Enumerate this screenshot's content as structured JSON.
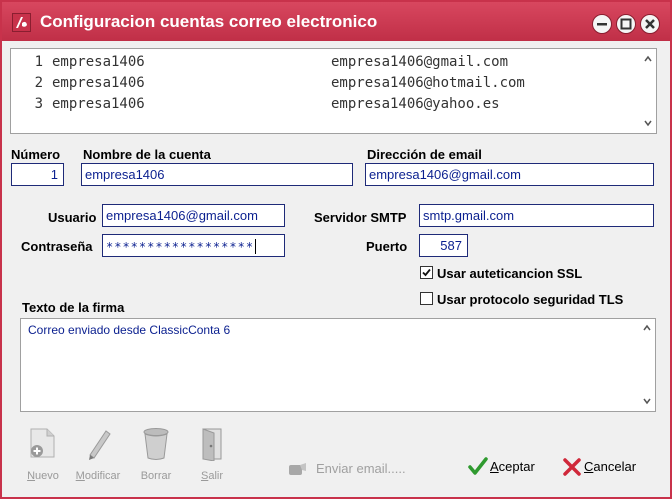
{
  "window": {
    "title": "Configuracion cuentas correo electronico",
    "accent_color": "#c8324b"
  },
  "accounts_list": {
    "rows": [
      {
        "number": "1",
        "name": "empresa1406",
        "email": "empresa1406@gmail.com"
      },
      {
        "number": "2",
        "name": "empresa1406",
        "email": "empresa1406@hotmail.com"
      },
      {
        "number": "3",
        "name": "empresa1406",
        "email": "empresa1406@yahoo.es"
      }
    ]
  },
  "form": {
    "numero_label": "Número",
    "numero_value": "1",
    "nombre_label": "Nombre de la cuenta",
    "nombre_value": "empresa1406",
    "direccion_label": "Dirección de email",
    "direccion_value": "empresa1406@gmail.com",
    "usuario_label": "Usuario",
    "usuario_value": "empresa1406@gmail.com",
    "contrasena_label": "Contraseña",
    "contrasena_value": "******************",
    "servidor_label": "Servidor SMTP",
    "servidor_value": "smtp.gmail.com",
    "puerto_label": "Puerto",
    "puerto_value": "587",
    "ssl_label": "Usar auteticancion SSL",
    "ssl_checked": true,
    "tls_label": "Usar protocolo seguridad TLS",
    "tls_checked": false,
    "firma_label": "Texto de la firma",
    "firma_value": "Correo enviado desde ClassicConta 6"
  },
  "toolbar": {
    "nuevo_first": "N",
    "nuevo_rest": "uevo",
    "modificar_first": "M",
    "modificar_rest": "odificar",
    "borrar_label": "Borrar",
    "salir_first": "S",
    "salir_rest": "alir",
    "enviar_label": "Enviar email....."
  },
  "dialog": {
    "aceptar_first": "A",
    "aceptar_rest": "ceptar",
    "cancelar_first": "C",
    "cancelar_rest": "ancelar"
  }
}
